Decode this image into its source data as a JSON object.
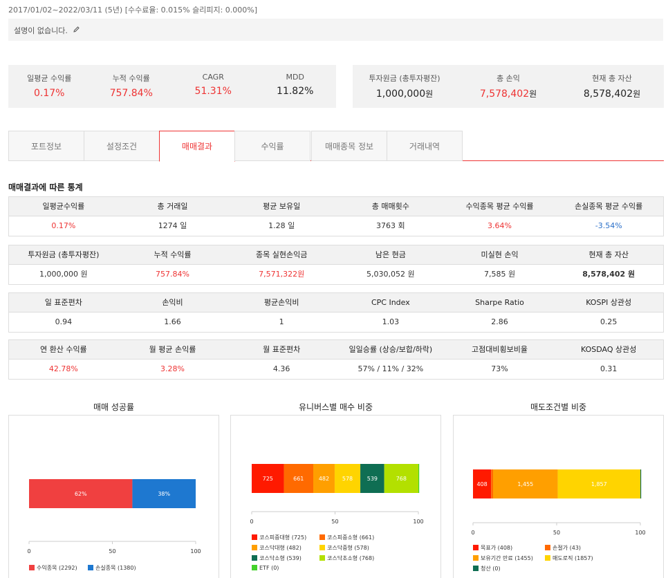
{
  "header": {
    "period": "2017/01/02~2022/03/11 (5년) [수수료율: 0.015% 슬리피지: 0.000%]",
    "description": "설명이 없습니다."
  },
  "summary_left": [
    {
      "label": "일평균 수익률",
      "value": "0.17%",
      "red": true
    },
    {
      "label": "누적 수익률",
      "value": "757.84%",
      "red": true
    },
    {
      "label": "CAGR",
      "value": "51.31%",
      "red": true
    },
    {
      "label": "MDD",
      "value": "11.82%",
      "red": false
    }
  ],
  "summary_right": [
    {
      "label": "투자원금 (총투자평잔)",
      "value": "1,000,000",
      "unit": "원",
      "red": false
    },
    {
      "label": "총 손익",
      "value": "7,578,402",
      "unit": "원",
      "red": true
    },
    {
      "label": "현재 총 자산",
      "value": "8,578,402",
      "unit": "원",
      "red": false
    }
  ],
  "tabs": [
    "포트정보",
    "설정조건",
    "매매결과",
    "수익률",
    "매매종목 정보",
    "거래내역"
  ],
  "active_tab": "매매결과",
  "section_title": "매매결과에 따른 통계",
  "stats": {
    "t1": {
      "headers": [
        "일평균수익률",
        "총 거래일",
        "평균 보유일",
        "총 매매횟수",
        "수익종목 평균 수익률",
        "손실종목 평균 수익률"
      ],
      "values": [
        "0.17%",
        "1274 일",
        "1.28 일",
        "3763 회",
        "3.64%",
        "-3.54%"
      ]
    },
    "t2": {
      "headers": [
        "투자원금 (총투자평잔)",
        "누적 수익률",
        "종목 실현손익금",
        "남은 현금",
        "미실현 손익",
        "현재 총 자산"
      ],
      "values": [
        "1,000,000 원",
        "757.84%",
        "7,571,322원",
        "5,030,052 원",
        "7,585 원",
        "8,578,402 원"
      ]
    },
    "t3": {
      "headers": [
        "일 표준편차",
        "손익비",
        "평균손익비",
        "CPC Index",
        "Sharpe Ratio",
        "KOSPI 상관성"
      ],
      "values": [
        "0.94",
        "1.66",
        "1",
        "1.03",
        "2.86",
        "0.25"
      ]
    },
    "t4": {
      "headers": [
        "연 환산 수익률",
        "월 평균 손익률",
        "월 표준편차",
        "일일승률 (상승/보합/하락)",
        "고점대비횡보비율",
        "KOSDAQ 상관성"
      ],
      "values": [
        "42.78%",
        "3.28%",
        "4.36",
        "57% / 11% / 32%",
        "73%",
        "0.31"
      ]
    }
  },
  "colors": {
    "accent": "#e33333",
    "blue": "#2a6fc9"
  },
  "chart_data": [
    {
      "type": "bar",
      "title": "매매 성공률",
      "orientation": "horizontal-stacked",
      "xlim": [
        0,
        100
      ],
      "ticks": [
        "0",
        "50",
        "100"
      ],
      "segments": [
        {
          "label": "62%",
          "value": 62,
          "color": "#f04040"
        },
        {
          "label": "38%",
          "value": 38,
          "color": "#1e78d0"
        }
      ],
      "legend": [
        {
          "name": "수익종목 (2292)",
          "color": "#f04040"
        },
        {
          "name": "손실종목 (1380)",
          "color": "#1e78d0"
        }
      ]
    },
    {
      "type": "bar",
      "title": "유니버스별 매수 비중",
      "orientation": "horizontal-stacked",
      "xlim": [
        0,
        100
      ],
      "ticks": [
        "0",
        "50",
        "100"
      ],
      "segments": [
        {
          "label": "725",
          "value": 725,
          "color": "#ff1a00"
        },
        {
          "label": "661",
          "value": 661,
          "color": "#ff6a00"
        },
        {
          "label": "482",
          "value": 482,
          "color": "#ff9f00"
        },
        {
          "label": "578",
          "value": 578,
          "color": "#ffd400"
        },
        {
          "label": "539",
          "value": 539,
          "color": "#0f6e53"
        },
        {
          "label": "768",
          "value": 768,
          "color": "#b3e000"
        },
        {
          "label": "",
          "value": 0.001,
          "color": "#43d22b"
        }
      ],
      "legend": [
        {
          "name": "코스피중대형 (725)",
          "color": "#ff1a00"
        },
        {
          "name": "코스피중소형 (661)",
          "color": "#ff6a00"
        },
        {
          "name": "코스닥대형 (482)",
          "color": "#ff9f00"
        },
        {
          "name": "코스닥중형 (578)",
          "color": "#ffd400"
        },
        {
          "name": "코스닥소형 (539)",
          "color": "#0f6e53"
        },
        {
          "name": "코스닥초소형 (768)",
          "color": "#b3e000"
        },
        {
          "name": "ETF (0)",
          "color": "#43d22b"
        }
      ]
    },
    {
      "type": "bar",
      "title": "매도조건별 비중",
      "orientation": "horizontal-stacked",
      "xlim": [
        0,
        100
      ],
      "ticks": [
        "0",
        "50",
        "100"
      ],
      "segments": [
        {
          "label": "408",
          "value": 408,
          "color": "#ff1a00"
        },
        {
          "label": "",
          "value": 43,
          "color": "#ff6a00"
        },
        {
          "label": "1,455",
          "value": 1455,
          "color": "#ff9f00"
        },
        {
          "label": "1,857",
          "value": 1857,
          "color": "#ffd400"
        },
        {
          "label": "",
          "value": 0.001,
          "color": "#0f6e53"
        }
      ],
      "legend": [
        {
          "name": "목표가 (408)",
          "color": "#ff1a00"
        },
        {
          "name": "손절가 (43)",
          "color": "#ff6a00"
        },
        {
          "name": "보유기간 만료 (1455)",
          "color": "#ff9f00"
        },
        {
          "name": "매도로직 (1857)",
          "color": "#ffd400"
        },
        {
          "name": "청산 (0)",
          "color": "#0f6e53"
        }
      ]
    }
  ]
}
